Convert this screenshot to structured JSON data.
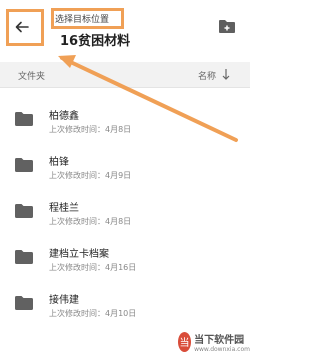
{
  "header": {
    "subtitle": "选择目标位置",
    "title": "16贫困材料"
  },
  "icons": {
    "back": "arrow-left-icon",
    "new_folder": "folder-add-icon",
    "folder": "folder-icon",
    "sort": "sort-arrow-icon"
  },
  "columns": {
    "left": "文件夹",
    "right": "名称"
  },
  "folders": [
    {
      "name": "柏德鑫",
      "meta": "上次修改时间：4月8日"
    },
    {
      "name": "柏锋",
      "meta": "上次修改时间：4月9日"
    },
    {
      "name": "程桂兰",
      "meta": "上次修改时间：4月8日"
    },
    {
      "name": "建档立卡档案",
      "meta": "上次修改时间：4月16日"
    },
    {
      "name": "接伟建",
      "meta": "上次修改时间：4月10日"
    }
  ],
  "watermark": {
    "logo": "当",
    "main": "当下软件园",
    "sub": "www.downxia.com"
  },
  "colors": {
    "accent": "#f0a056",
    "folder": "#616161"
  }
}
